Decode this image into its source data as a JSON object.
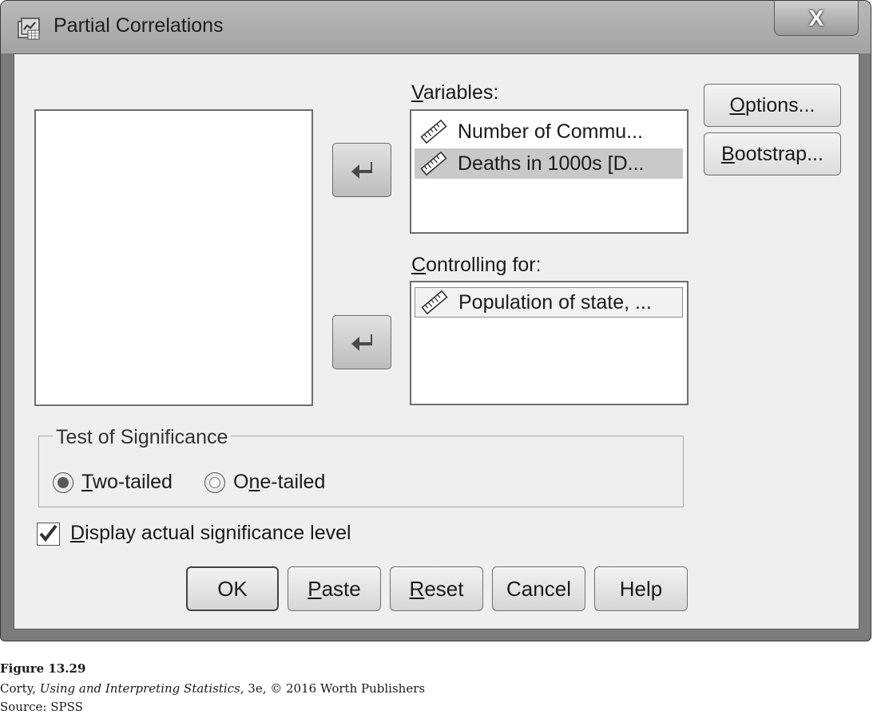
{
  "window": {
    "title": "Partial Correlations",
    "close_label": "X"
  },
  "labels": {
    "variables_prefix": "V",
    "variables_rest": "ariables:",
    "controlling_prefix": "C",
    "controlling_rest": "ontrolling for:"
  },
  "variables_list": [
    {
      "label": "Number of Commu...",
      "icon": "scale-ruler-icon",
      "selected": false
    },
    {
      "label": "Deaths in 1000s [D...",
      "icon": "scale-ruler-icon",
      "selected": true
    }
  ],
  "controlling_list": [
    {
      "label": "Population of state, ...",
      "icon": "scale-ruler-icon",
      "focused": true
    }
  ],
  "side_buttons": {
    "options_prefix": "O",
    "options_rest": "ptions...",
    "bootstrap_prefix": "B",
    "bootstrap_rest": "ootstrap..."
  },
  "significance": {
    "group_title": "Test of Significance",
    "two_tailed_prefix": "T",
    "two_tailed_rest": "wo-tailed",
    "one_tailed_a": "O",
    "one_tailed_u": "n",
    "one_tailed_b": "e-tailed",
    "selected": "Two-tailed"
  },
  "display_sig": {
    "prefix": "D",
    "rest": "isplay actual significance level",
    "checked": true
  },
  "bottom_buttons": {
    "ok": "OK",
    "paste_prefix": "P",
    "paste_rest": "aste",
    "reset_prefix": "R",
    "reset_rest": "eset",
    "cancel": "Cancel",
    "help": "Help"
  },
  "caption": {
    "figure": "Figure 13.29",
    "author": "Corty, ",
    "book": "Using and Interpreting Statistics",
    "rest": ", 3e, © 2016 Worth Publishers",
    "source": "Source: SPSS"
  },
  "colors": {
    "frame": "#7b7b7b",
    "client": "#efefef",
    "selection": "#c9c9c9"
  }
}
